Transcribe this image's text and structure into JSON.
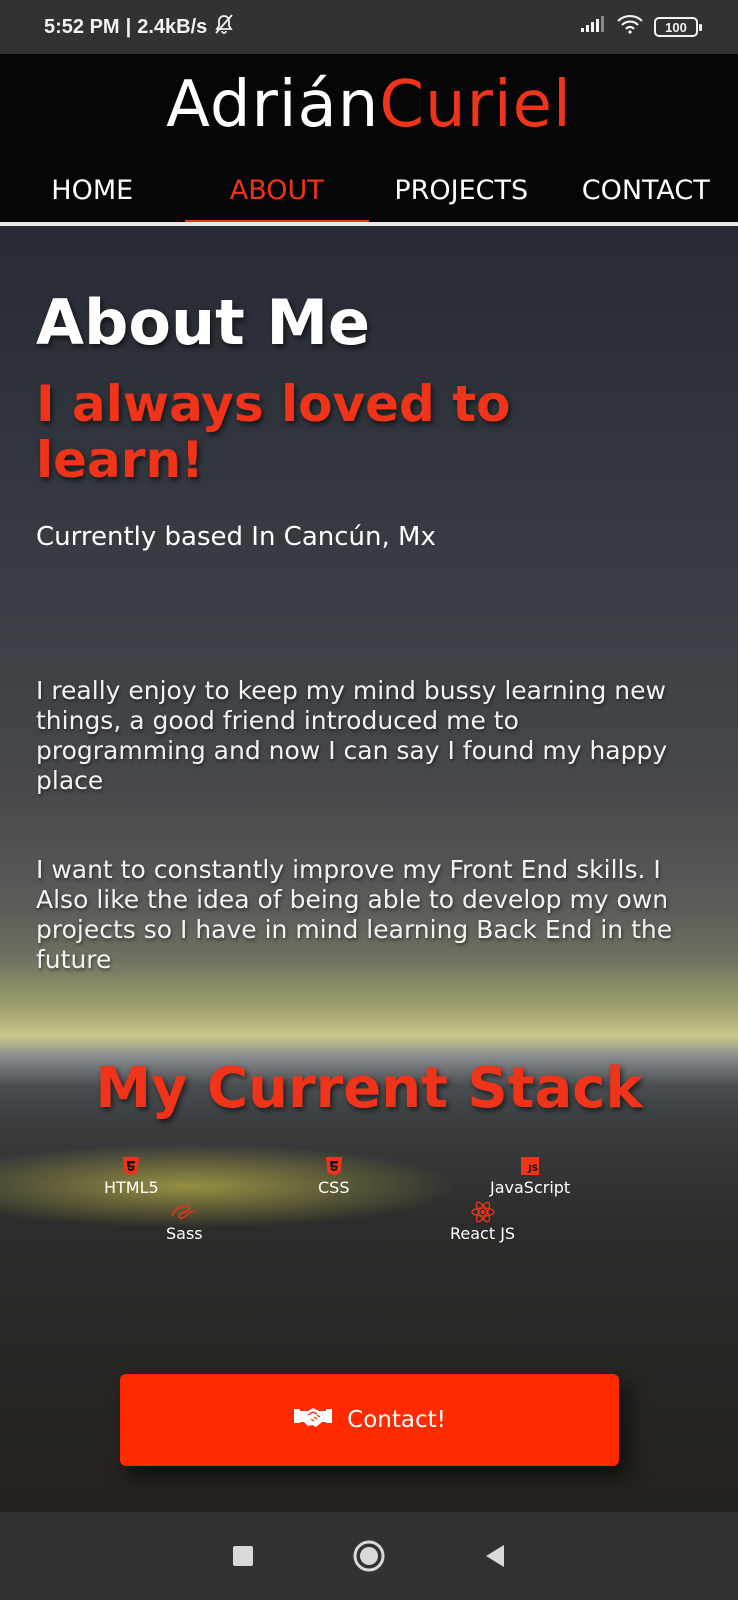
{
  "status_bar": {
    "time": "5:52 PM",
    "separator": "|",
    "net_speed": "2.4kB/s",
    "battery": "100",
    "icons": [
      "muted-bell-icon",
      "signal-icon",
      "wifi-icon",
      "battery-icon"
    ]
  },
  "header": {
    "brand_first": "Adrián",
    "brand_last": "Curiel",
    "nav": [
      {
        "label": "HOME",
        "active": false
      },
      {
        "label": "ABOUT",
        "active": true
      },
      {
        "label": "PROJECTS",
        "active": false
      },
      {
        "label": "CONTACT",
        "active": false
      }
    ]
  },
  "about": {
    "title": "About Me",
    "tagline": "I always loved to learn!",
    "location": "Currently based In Cancún, Mx",
    "paragraphs": [
      "I really enjoy to keep my mind bussy learning new things, a good friend introduced me to programming and now I can say I found my happy place",
      "I want to constantly improve my Front End skills. I Also like the idea of being able to develop my own projects so I have in mind learning Back End in the future"
    ]
  },
  "stack": {
    "title": "My Current Stack",
    "items": [
      {
        "label": "HTML5",
        "icon": "html5-icon"
      },
      {
        "label": "CSS",
        "icon": "css3-icon"
      },
      {
        "label": "JavaScript",
        "icon": "javascript-icon"
      },
      {
        "label": "Sass",
        "icon": "sass-icon"
      },
      {
        "label": "React JS",
        "icon": "react-icon"
      }
    ]
  },
  "cta": {
    "label": "Contact!",
    "icon": "handshake-icon"
  },
  "colors": {
    "accent": "#f0341a",
    "button": "#ff2a00",
    "header_bg": "#050607"
  },
  "system_nav": [
    "recents-square-icon",
    "home-circle-icon",
    "back-triangle-icon"
  ]
}
